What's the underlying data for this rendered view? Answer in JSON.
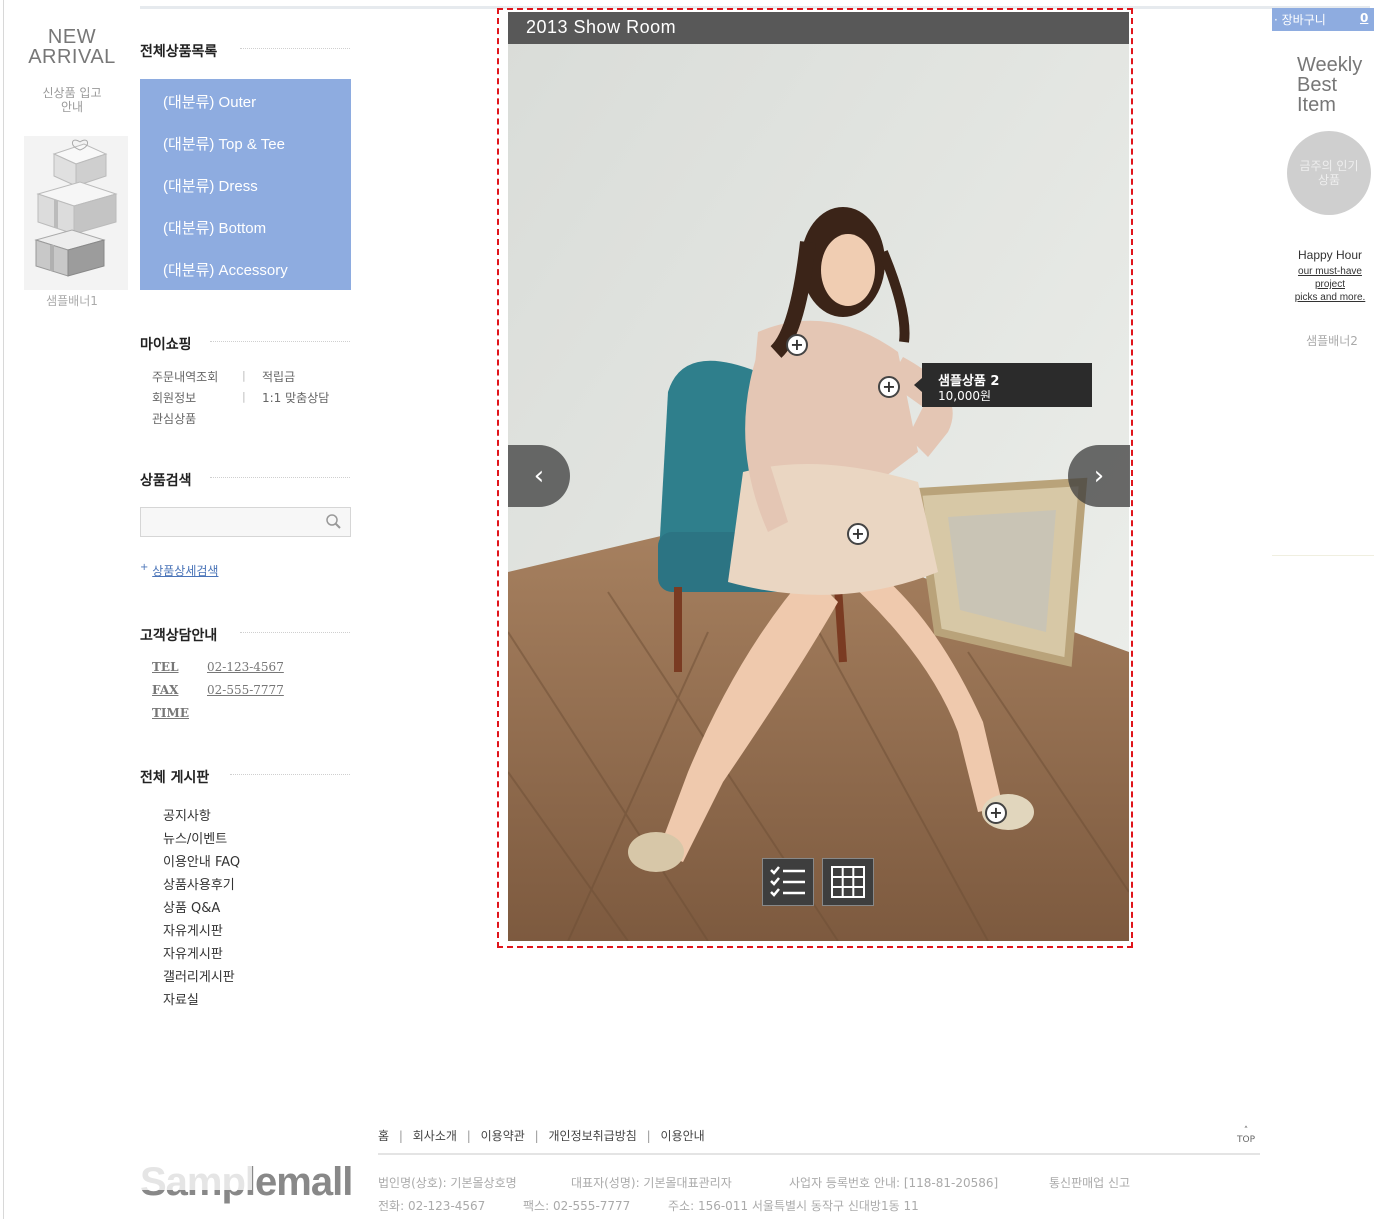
{
  "left_banner": {
    "title_line1": "NEW",
    "title_line2": "ARRIVAL",
    "sub_line1": "신상품 입고",
    "sub_line2": "안내",
    "banner_label": "샘플배너1"
  },
  "categories": {
    "heading": "전체상품목록",
    "items": [
      {
        "label": "(대분류) Outer"
      },
      {
        "label": "(대분류) Top & Tee"
      },
      {
        "label": "(대분류) Dress"
      },
      {
        "label": "(대분류) Bottom"
      },
      {
        "label": "(대분류) Accessory"
      }
    ]
  },
  "my_shopping": {
    "heading": "마이쇼핑",
    "separator": "|",
    "links": [
      "주문내역조회",
      "적립금",
      "회원정보",
      "1:1 맞춤상담",
      "관심상품"
    ]
  },
  "product_search": {
    "heading": "상품검색",
    "input_value": "",
    "advanced_link": "상품상세검색",
    "advanced_prefix": "+"
  },
  "customer_service": {
    "heading": "고객상담안내",
    "tel_label": "TEL",
    "tel_value": "02-123-4567",
    "fax_label": "FAX",
    "fax_value": "02-555-7777",
    "time_label": "TIME"
  },
  "boards": {
    "heading": "전체 게시판",
    "items": [
      "공지사항",
      "뉴스/이벤트",
      "이용안내 FAQ",
      "상품사용후기",
      "상품 Q&A",
      "자유게시판",
      "자유게시판",
      "갤러리게시판",
      "자료실"
    ]
  },
  "show_room": {
    "title": "2013 Show Room",
    "prev_glyph": "‹",
    "next_glyph": "›",
    "hotspot_glyph": "+",
    "tooltip": {
      "name": "샘플상품 2",
      "price": "10,000원"
    }
  },
  "right_banner": {
    "cart_label": "· 장바구니",
    "cart_count": "0",
    "weekly_line1": "Weekly",
    "weekly_line2": "Best",
    "weekly_line3": "Item",
    "popular_line1": "금주의 인기",
    "popular_line2": "상품",
    "happy_title": "Happy Hour",
    "happy_line1": "our must-have",
    "happy_line2": "project",
    "happy_line3": "picks and more.",
    "banner_label": "샘플배너2"
  },
  "footer": {
    "nav": [
      "홈",
      "회사소개",
      "이용약관",
      "개인정보취급방침",
      "이용안내"
    ],
    "nav_separator": "|",
    "top_label": "TOP",
    "logo_text": "Samplemall",
    "info_row1": [
      "법인명(상호): 기본몰상호명",
      "대표자(성명): 기본몰대표관리자",
      "사업자 등록번호 안내: [118-81-20586]",
      "통신판매업 신고"
    ],
    "info_row2": [
      "전화: 02-123-4567",
      "팩스: 02-555-7777",
      "주소: 156-011 서울특별시 동작구 신대방1동 11"
    ]
  },
  "colors": {
    "accent": "#8eace0",
    "frame": "#e0141b",
    "header_bar": "#585858"
  },
  "icons": [
    "search-icon",
    "gift-box-image",
    "chevron-left-icon",
    "chevron-right-icon",
    "plus-icon",
    "list-view-icon",
    "grid-view-icon"
  ]
}
